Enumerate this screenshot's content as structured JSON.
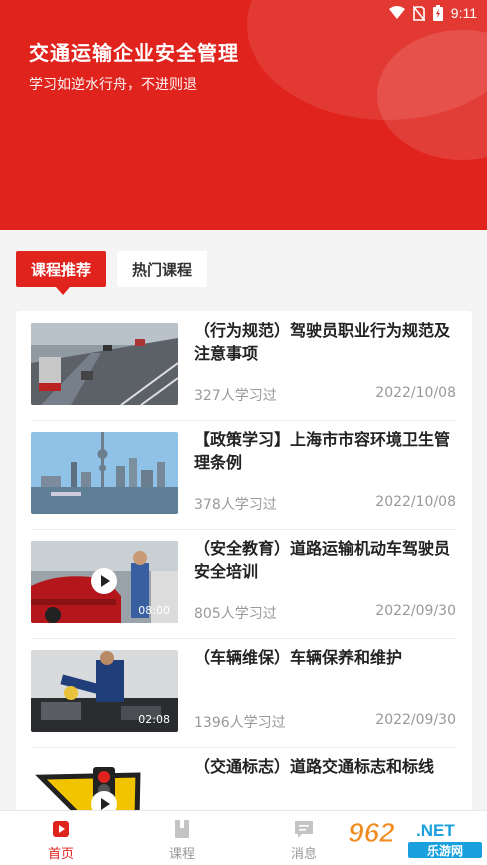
{
  "status_bar": {
    "time": "9:11"
  },
  "header": {
    "title": "交通运输企业安全管理",
    "subtitle": "学习如逆水行舟，不进则退"
  },
  "tabs": [
    {
      "label": "课程推荐",
      "active": true
    },
    {
      "label": "热门课程",
      "active": false
    }
  ],
  "courses": [
    {
      "title": "（行为规范）驾驶员职业行为规范及注意事项",
      "learners": "327人学习过",
      "date": "2022/10/08",
      "thumb": "highway-traffic",
      "video": false,
      "duration": ""
    },
    {
      "title": "【政策学习】上海市市容环境卫生管理条例",
      "learners": "378人学习过",
      "date": "2022/10/08",
      "thumb": "shanghai-skyline",
      "video": false,
      "duration": ""
    },
    {
      "title": "（安全教育）道路运输机动车驾驶员安全培训",
      "learners": "805人学习过",
      "date": "2022/09/30",
      "thumb": "car-inspection",
      "video": true,
      "duration": "08:00"
    },
    {
      "title": "（车辆维保）车辆保养和维护",
      "learners": "1396人学习过",
      "date": "2022/09/30",
      "thumb": "engine-maintenance",
      "video": true,
      "duration": "02:08"
    },
    {
      "title": "（交通标志）道路交通标志和标线",
      "learners": "",
      "date": "",
      "thumb": "traffic-sign",
      "video": true,
      "duration": ""
    }
  ],
  "bottom_nav": [
    {
      "label": "首页",
      "icon": "home-icon",
      "active": true
    },
    {
      "label": "课程",
      "icon": "book-icon",
      "active": false
    },
    {
      "label": "消息",
      "icon": "message-icon",
      "active": false
    }
  ],
  "watermark": {
    "number": "962",
    "suffix": ".NET",
    "caption": "乐游网"
  },
  "colors": {
    "primary": "#e0231c",
    "muted": "#999999",
    "background": "#f4f4f4"
  }
}
